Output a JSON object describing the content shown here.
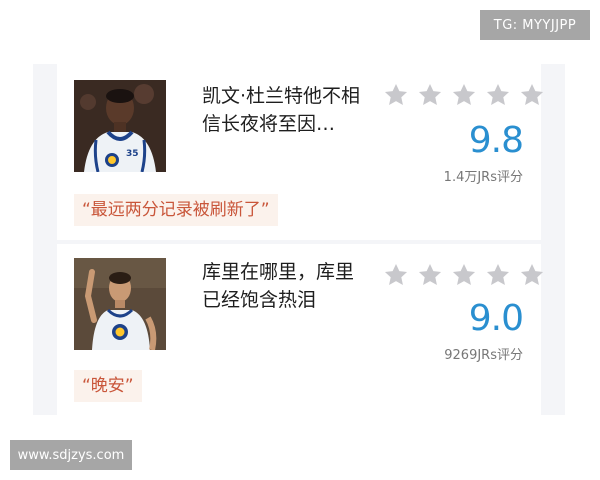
{
  "watermarks": {
    "top": "TG: MYYJJPP",
    "bottom": "www.sdjzys.com"
  },
  "colors": {
    "score_blue": "#2a8fd0",
    "star_gray": "#c8c8cc",
    "quote_text": "#c9563a",
    "quote_bg": "#fbf2ec",
    "panel_bg": "#f4f5f8"
  },
  "cards": [
    {
      "title": "凯文·杜兰特他不相信长夜将至因…",
      "score": "9.8",
      "raters": "1.4万JRs评分",
      "quote": "“最远两分记录被刷新了”",
      "stars": 5,
      "jersey_number": "35"
    },
    {
      "title": "库里在哪里，库里已经饱含热泪",
      "score": "9.0",
      "raters": "9269JRs评分",
      "quote": "“晚安”",
      "stars": 5,
      "jersey_number": ""
    }
  ]
}
